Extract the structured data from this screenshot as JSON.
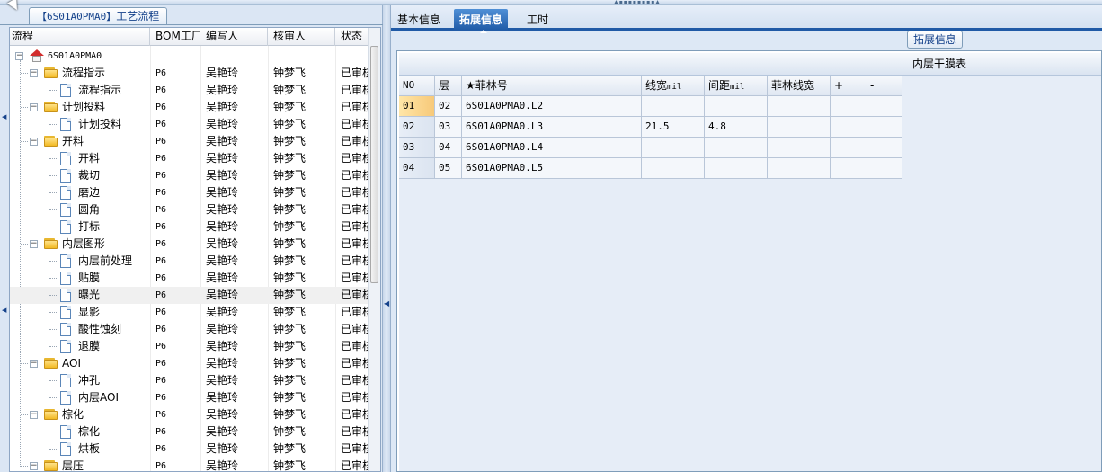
{
  "left_panel": {
    "title_bom": "【6S01A0PMA0】",
    "title_label": "工艺流程",
    "columns": [
      "流程",
      "BOM工厂",
      "编写人",
      "核审人",
      "状态"
    ],
    "root": "6S01A0PMA0",
    "rows": [
      {
        "label": "流程指示",
        "kind": "folder",
        "factory": "P6",
        "writer": "吴艳玲",
        "reviewer": "钟梦飞",
        "status": "已审核"
      },
      {
        "label": "流程指示",
        "kind": "doc",
        "factory": "P6",
        "writer": "吴艳玲",
        "reviewer": "钟梦飞",
        "status": "已审核"
      },
      {
        "label": "计划投料",
        "kind": "folder",
        "factory": "P6",
        "writer": "吴艳玲",
        "reviewer": "钟梦飞",
        "status": "已审核"
      },
      {
        "label": "计划投料",
        "kind": "doc",
        "factory": "P6",
        "writer": "吴艳玲",
        "reviewer": "钟梦飞",
        "status": "已审核"
      },
      {
        "label": "开料",
        "kind": "folder",
        "factory": "P6",
        "writer": "吴艳玲",
        "reviewer": "钟梦飞",
        "status": "已审核"
      },
      {
        "label": "开料",
        "kind": "doc",
        "factory": "P6",
        "writer": "吴艳玲",
        "reviewer": "钟梦飞",
        "status": "已审核"
      },
      {
        "label": "裁切",
        "kind": "doc",
        "factory": "P6",
        "writer": "吴艳玲",
        "reviewer": "钟梦飞",
        "status": "已审核"
      },
      {
        "label": "磨边",
        "kind": "doc",
        "factory": "P6",
        "writer": "吴艳玲",
        "reviewer": "钟梦飞",
        "status": "已审核"
      },
      {
        "label": "圆角",
        "kind": "doc",
        "factory": "P6",
        "writer": "吴艳玲",
        "reviewer": "钟梦飞",
        "status": "已审核"
      },
      {
        "label": "打标",
        "kind": "doc",
        "factory": "P6",
        "writer": "吴艳玲",
        "reviewer": "钟梦飞",
        "status": "已审核"
      },
      {
        "label": "内层图形",
        "kind": "folder",
        "factory": "P6",
        "writer": "吴艳玲",
        "reviewer": "钟梦飞",
        "status": "已审核"
      },
      {
        "label": "内层前处理",
        "kind": "doc",
        "factory": "P6",
        "writer": "吴艳玲",
        "reviewer": "钟梦飞",
        "status": "已审核"
      },
      {
        "label": "贴膜",
        "kind": "doc",
        "factory": "P6",
        "writer": "吴艳玲",
        "reviewer": "钟梦飞",
        "status": "已审核"
      },
      {
        "label": "曝光",
        "kind": "doc",
        "factory": "P6",
        "writer": "吴艳玲",
        "reviewer": "钟梦飞",
        "status": "已审核",
        "selected": true
      },
      {
        "label": "显影",
        "kind": "doc",
        "factory": "P6",
        "writer": "吴艳玲",
        "reviewer": "钟梦飞",
        "status": "已审核"
      },
      {
        "label": "酸性蚀刻",
        "kind": "doc",
        "factory": "P6",
        "writer": "吴艳玲",
        "reviewer": "钟梦飞",
        "status": "已审核"
      },
      {
        "label": "退膜",
        "kind": "doc",
        "factory": "P6",
        "writer": "吴艳玲",
        "reviewer": "钟梦飞",
        "status": "已审核"
      },
      {
        "label": "AOI",
        "kind": "folder",
        "factory": "P6",
        "writer": "吴艳玲",
        "reviewer": "钟梦飞",
        "status": "已审核"
      },
      {
        "label": "冲孔",
        "kind": "doc",
        "factory": "P6",
        "writer": "吴艳玲",
        "reviewer": "钟梦飞",
        "status": "已审核"
      },
      {
        "label": "内层AOI",
        "kind": "doc",
        "factory": "P6",
        "writer": "吴艳玲",
        "reviewer": "钟梦飞",
        "status": "已审核"
      },
      {
        "label": "棕化",
        "kind": "folder",
        "factory": "P6",
        "writer": "吴艳玲",
        "reviewer": "钟梦飞",
        "status": "已审核"
      },
      {
        "label": "棕化",
        "kind": "doc",
        "factory": "P6",
        "writer": "吴艳玲",
        "reviewer": "钟梦飞",
        "status": "已审核"
      },
      {
        "label": "烘板",
        "kind": "doc",
        "factory": "P6",
        "writer": "吴艳玲",
        "reviewer": "钟梦飞",
        "status": "已审核"
      },
      {
        "label": "层压",
        "kind": "folder",
        "factory": "P6",
        "writer": "吴艳玲",
        "reviewer": "钟梦飞",
        "status": "已审核"
      }
    ]
  },
  "right_panel": {
    "tabs": [
      {
        "label": "基本信息",
        "active": false
      },
      {
        "label": "拓展信息",
        "active": true
      },
      {
        "label": "工时",
        "active": false
      }
    ],
    "group_title": "拓展信息",
    "grid_caption": "内层干膜表",
    "grid": {
      "headers": [
        {
          "text": "NO",
          "unit": ""
        },
        {
          "text": "层",
          "unit": ""
        },
        {
          "text": "★菲林号",
          "unit": ""
        },
        {
          "text": "线宽",
          "unit": "mil"
        },
        {
          "text": "间距",
          "unit": "mil"
        },
        {
          "text": "菲林线宽",
          "unit": ""
        },
        {
          "text": "+",
          "unit": ""
        },
        {
          "text": "-",
          "unit": ""
        }
      ],
      "rows": [
        {
          "no": "01",
          "layer": "02",
          "film": "6S01A0PMA0.L2",
          "width": "",
          "spacing": "",
          "film_width": "",
          "plus": "",
          "minus": "",
          "active": true
        },
        {
          "no": "02",
          "layer": "03",
          "film": "6S01A0PMA0.L3",
          "width": "21.5",
          "spacing": "4.8",
          "film_width": "",
          "plus": "",
          "minus": ""
        },
        {
          "no": "03",
          "layer": "04",
          "film": "6S01A0PMA0.L4",
          "width": "",
          "spacing": "",
          "film_width": "",
          "plus": "",
          "minus": ""
        },
        {
          "no": "04",
          "layer": "05",
          "film": "6S01A0PMA0.L5",
          "width": "",
          "spacing": "",
          "film_width": "",
          "plus": "",
          "minus": ""
        }
      ]
    }
  },
  "colors": {
    "accent": "#1f5aa6",
    "panel_bg": "#dde8f5",
    "active_row": "#f7c979"
  }
}
